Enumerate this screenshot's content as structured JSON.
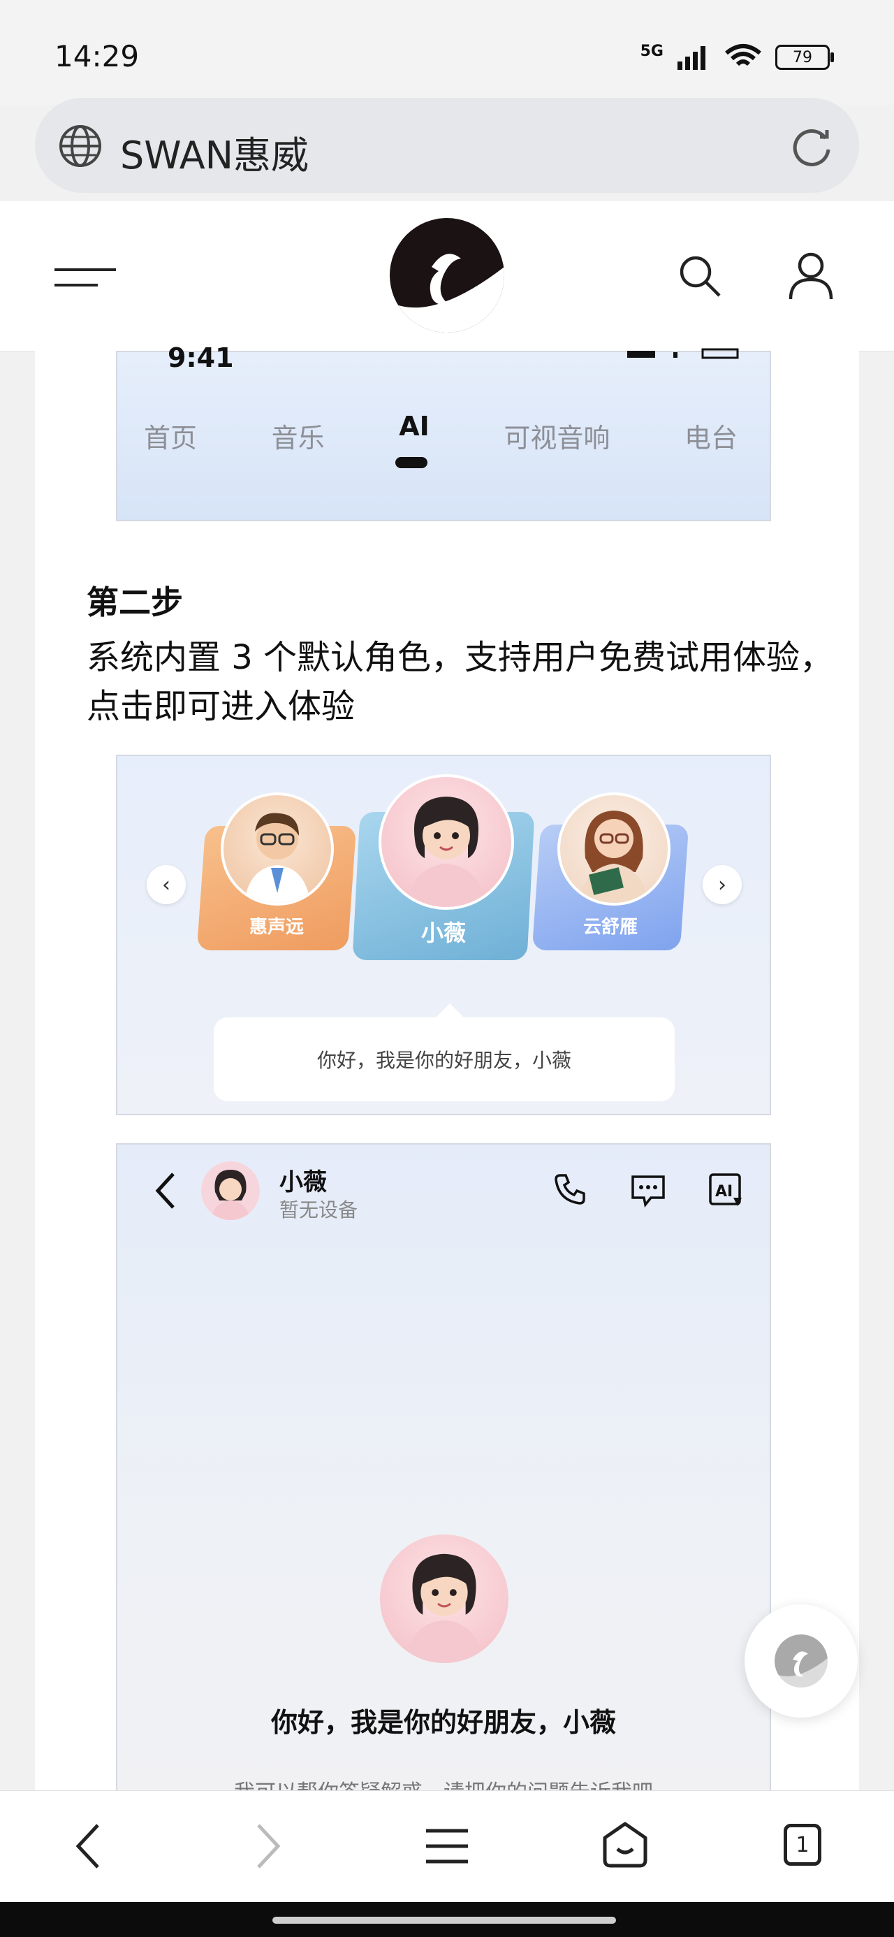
{
  "status_bar": {
    "time": "14:29",
    "network": "5G",
    "battery": "79"
  },
  "browser": {
    "url_title": "SWAN惠威"
  },
  "app_screenshot_1": {
    "time": "9:41",
    "tabs": [
      "首页",
      "音乐",
      "AI",
      "可视音响",
      "电台"
    ],
    "active_tab": "AI"
  },
  "step": {
    "title": "第二步",
    "description": "系统内置 3 个默认角色，支持用户免费试用体验，点击即可进入体验"
  },
  "roles": {
    "items": [
      {
        "name": "惠声远",
        "color": "#f2a56a"
      },
      {
        "name": "小薇",
        "color": "#7fb8dc"
      },
      {
        "name": "云舒雁",
        "color": "#8eaef3"
      }
    ],
    "greeting": "你好，我是你的好朋友，小薇"
  },
  "chat": {
    "name": "小薇",
    "device_status": "暂无设备",
    "greeting": "你好，我是你的好朋友，小薇",
    "subtext": "我可以帮你答疑解惑，请把你的问题告诉我吧"
  },
  "bottom_nav": {
    "tabs_count": "1"
  },
  "colors": {
    "accent_dark": "#1b1313",
    "tab_inactive": "#8d8f96"
  }
}
